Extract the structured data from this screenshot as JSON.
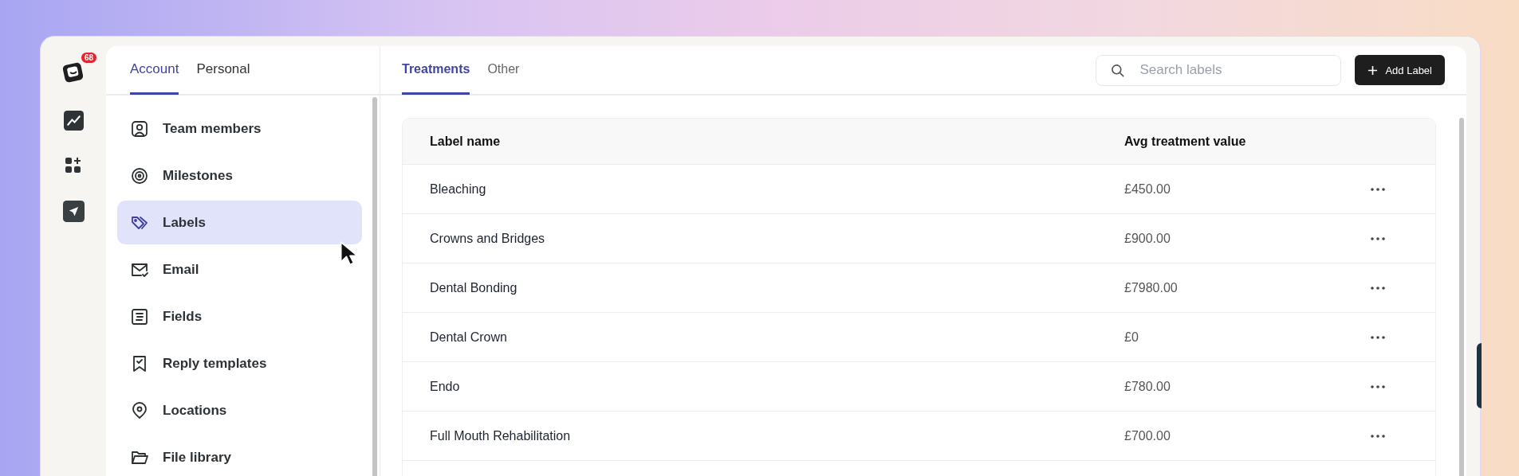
{
  "rail": {
    "badge": "68"
  },
  "settings_tabs": [
    {
      "label": "Account",
      "selected": true
    },
    {
      "label": "Personal",
      "selected": false
    }
  ],
  "sidebar": {
    "items": [
      {
        "label": "Team members",
        "selected": false
      },
      {
        "label": "Milestones",
        "selected": false
      },
      {
        "label": "Labels",
        "selected": true
      },
      {
        "label": "Email",
        "selected": false
      },
      {
        "label": "Fields",
        "selected": false
      },
      {
        "label": "Reply templates",
        "selected": false
      },
      {
        "label": "Locations",
        "selected": false
      },
      {
        "label": "File library",
        "selected": false
      }
    ]
  },
  "content_tabs": [
    {
      "label": "Treatments",
      "selected": true
    },
    {
      "label": "Other",
      "selected": false
    }
  ],
  "search": {
    "placeholder": "Search labels"
  },
  "add_button": {
    "label": "Add Label"
  },
  "table": {
    "columns": [
      "Label name",
      "Avg treatment value"
    ],
    "rows": [
      {
        "name": "Bleaching",
        "value": "£450.00"
      },
      {
        "name": "Crowns and Bridges",
        "value": "£900.00"
      },
      {
        "name": "Dental Bonding",
        "value": "£7980.00"
      },
      {
        "name": "Dental Crown",
        "value": "£0"
      },
      {
        "name": "Endo",
        "value": "£780.00"
      },
      {
        "name": "Full Mouth Rehabilitation",
        "value": "£700.00"
      }
    ]
  }
}
